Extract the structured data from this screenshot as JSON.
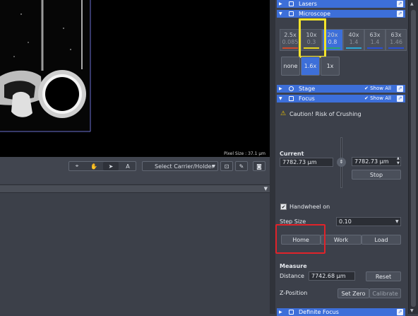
{
  "viewer": {
    "pixel_size": "Pixel Size : 37.1 µm"
  },
  "view_toolbar": {
    "carrier_select": "Select Carrier/Holder",
    "text_tool": "A"
  },
  "panel": {
    "lasers": {
      "title": "Lasers"
    },
    "microscope": {
      "title": "Microscope",
      "objectives": [
        {
          "mag": "2.5x",
          "na": "0.085",
          "color": "#d04a2a"
        },
        {
          "mag": "10x",
          "na": "0.3",
          "color": "#e6d21e"
        },
        {
          "mag": "20x",
          "na": "0.8",
          "color": "#2ea36a"
        },
        {
          "mag": "40x",
          "na": "1.4",
          "color": "#2aa8d6"
        },
        {
          "mag": "63x",
          "na": "1.4",
          "color": "#2a4fd6"
        },
        {
          "mag": "63x",
          "na": "1.46",
          "color": "#2a4fd6"
        }
      ],
      "optovar": [
        "none",
        "1.6x",
        "1x"
      ]
    },
    "stage": {
      "title": "Stage",
      "show_all": "Show All"
    },
    "focus": {
      "title": "Focus",
      "show_all": "Show All",
      "caution": "Caution! Risk of Crushing",
      "current_label": "Current",
      "current_value": "7782.73 µm",
      "target_value": "7782.73 µm",
      "stop": "Stop",
      "handwheel": "Handwheel on",
      "step_size_label": "Step Size",
      "step_size_value": "0.10",
      "home": "Home",
      "work": "Work",
      "load": "Load",
      "measure_label": "Measure",
      "distance_label": "Distance",
      "distance_value": "7742.68 µm",
      "reset": "Reset",
      "zpos_label": "Z-Position",
      "set_zero": "Set Zero",
      "calibrate": "Calibrate"
    },
    "definite_focus": {
      "title": "Definite Focus"
    }
  },
  "colors": {
    "header_blue": "#3d6fd9",
    "highlight_red": "#e0232a",
    "highlight_yellow": "#f3e32a",
    "selected_blue": "#3d6fd9"
  }
}
